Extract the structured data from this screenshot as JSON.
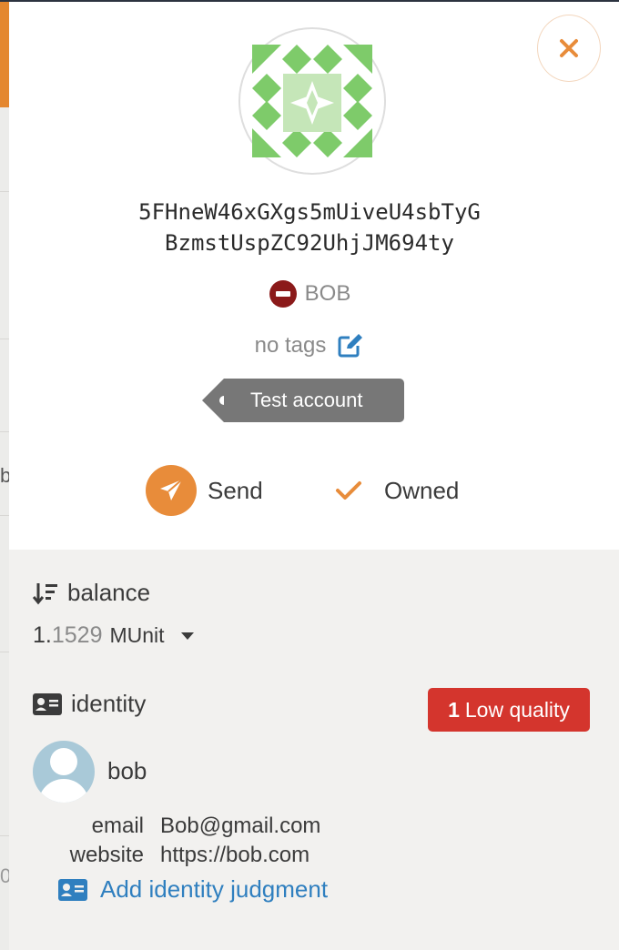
{
  "account": {
    "address_line1": "5FHneW46xGXgs5mUiveU4sbTyG",
    "address_line2": "BzmstUspZC92UhjJM694ty",
    "name": "BOB",
    "tags_text": "no tags",
    "tag_label": "Test account"
  },
  "actions": {
    "send_label": "Send",
    "owned_label": "Owned"
  },
  "balance": {
    "label": "balance",
    "integer": "1.",
    "fraction": "1529",
    "unit": "MUnit"
  },
  "identity": {
    "label": "identity",
    "quality_count": "1",
    "quality_label": "Low quality",
    "display_name": "bob",
    "fields": [
      {
        "label": "email",
        "value": "Bob@gmail.com"
      },
      {
        "label": "website",
        "value": "https://bob.com"
      }
    ],
    "add_judgment_label": "Add identity judgment"
  },
  "background": {
    "partial_chars": [
      "b",
      "0"
    ]
  },
  "colors": {
    "accent": "#e88c3a",
    "identicon_green": "#7ecb6a",
    "identicon_light": "#c5e6b8",
    "badge_red": "#d4352d",
    "name_icon_red": "#8b1a1a",
    "link_blue": "#2f7fbf",
    "tag_gray": "#777777"
  },
  "icons": [
    "close-icon",
    "identicon",
    "remove-circle-icon",
    "edit-icon",
    "paper-plane-icon",
    "check-icon",
    "sort-amount-icon",
    "id-card-icon",
    "caret-down-icon",
    "avatar-user-icon"
  ]
}
